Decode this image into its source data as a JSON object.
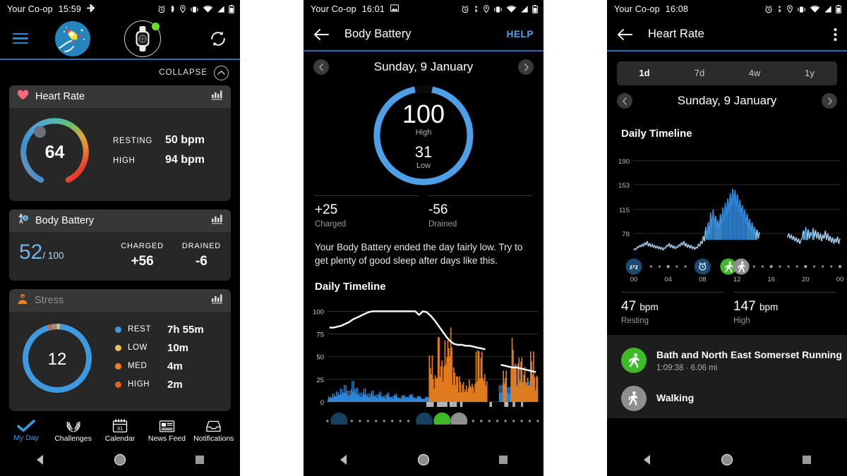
{
  "statusbar": {
    "carrier": "Your Co-op",
    "times": {
      "left": "15:59",
      "middle": "16:01",
      "right": "16:08"
    },
    "icons": [
      "alarm-icon",
      "bluetooth-icon",
      "location-icon",
      "vibrate-icon",
      "wifi-icon",
      "signal-icon",
      "battery-icon"
    ]
  },
  "left": {
    "collapse_label": "COLLAPSE",
    "heart_rate": {
      "title": "Heart Rate",
      "current": "64",
      "rows": [
        {
          "label": "RESTING",
          "value": "50 bpm"
        },
        {
          "label": "HIGH",
          "value": "94 bpm"
        }
      ]
    },
    "body_battery": {
      "title": "Body Battery",
      "value": "52",
      "denominator": "/ 100",
      "columns": [
        {
          "label": "CHARGED",
          "value": "+56"
        },
        {
          "label": "DRAINED",
          "value": "-6"
        }
      ]
    },
    "stress": {
      "title": "Stress",
      "value": "12",
      "legend": [
        {
          "label": "REST",
          "value": "7h 55m",
          "color": "#3d9ae0"
        },
        {
          "label": "LOW",
          "value": "10m",
          "color": "#f4b860"
        },
        {
          "label": "MED",
          "value": "4m",
          "color": "#ef8020"
        },
        {
          "label": "HIGH",
          "value": "2m",
          "color": "#e8601c"
        }
      ]
    },
    "bottom_nav": [
      {
        "label": "My Day",
        "icon": "check-icon",
        "active": true
      },
      {
        "label": "Challenges",
        "icon": "laurel-icon",
        "active": false
      },
      {
        "label": "Calendar",
        "icon": "calendar-icon",
        "active": false
      },
      {
        "label": "News Feed",
        "icon": "newspaper-icon",
        "active": false
      },
      {
        "label": "Notifications",
        "icon": "inbox-icon",
        "active": false
      }
    ]
  },
  "middle": {
    "title": "Body Battery",
    "help_label": "HELP",
    "date": "Sunday, 9 January",
    "gauge": {
      "high": "100",
      "high_label": "High",
      "low": "31",
      "low_label": "Low"
    },
    "stats": [
      {
        "value": "+25",
        "label": "Charged"
      },
      {
        "value": "-56",
        "label": "Drained"
      }
    ],
    "advice": "Your Body Battery ended the day fairly low. Try to get plenty of good sleep after days like this.",
    "section_title": "Daily Timeline"
  },
  "right": {
    "title": "Heart Rate",
    "segments": [
      {
        "label": "1d",
        "active": true
      },
      {
        "label": "7d",
        "active": false
      },
      {
        "label": "4w",
        "active": false
      },
      {
        "label": "1y",
        "active": false
      }
    ],
    "date": "Sunday, 9 January",
    "section_title": "Daily Timeline",
    "stats": [
      {
        "value": "47",
        "unit": "bpm",
        "label": "Resting"
      },
      {
        "value": "147",
        "unit": "bpm",
        "label": "High"
      }
    ],
    "activities": [
      {
        "name": "Bath and North East Somerset Running",
        "meta": "1:09:38 · 6.06 mi",
        "icon": "running-icon",
        "color": "#3dbb27"
      },
      {
        "name": "Walking",
        "meta": "",
        "icon": "walking-icon",
        "color": "#8f8f8f"
      }
    ]
  },
  "colors": {
    "accent_blue": "#1b72b8",
    "link_blue": "#4ca6e8",
    "running_green": "#3dbb27",
    "walking_grey": "#8f8f8f",
    "stress_orange": "#ef8020",
    "card_bg": "#272727",
    "card_head_bg": "#373737"
  },
  "chart_data": [
    {
      "type": "area",
      "title": "Daily Timeline",
      "panel": "middle-body-battery",
      "ylabel": "",
      "xlabel": "",
      "ylim": [
        0,
        105
      ],
      "yticks": [
        0,
        25,
        50,
        75,
        100
      ],
      "grid": true,
      "series": [
        {
          "name": "Body Battery",
          "color": "#ffffff",
          "type": "line",
          "x": [
            0,
            1,
            2,
            3,
            4,
            5,
            6,
            7,
            8,
            9,
            10,
            11,
            12,
            13,
            14,
            15,
            16,
            17,
            18,
            19,
            20,
            21,
            22,
            23,
            24,
            25,
            26,
            27,
            28,
            29,
            30,
            31,
            32,
            33,
            34,
            35,
            36,
            37,
            38,
            39,
            40,
            41,
            42,
            43,
            44,
            45,
            46,
            47,
            48,
            49,
            50,
            51,
            52,
            53
          ],
          "values": [
            82,
            82,
            83,
            84,
            86,
            88,
            91,
            93,
            95,
            97,
            99,
            100,
            100,
            100,
            100,
            100,
            100,
            100,
            100,
            100,
            100,
            100,
            100,
            96,
            100,
            99,
            95,
            90,
            84,
            78,
            72,
            67,
            64,
            63,
            63,
            62,
            62,
            61,
            60,
            59,
            58,
            null,
            null,
            null,
            41,
            40,
            39,
            38,
            38,
            37,
            36,
            35,
            34,
            33
          ]
        },
        {
          "name": "Rest (recovery)",
          "color": "#2f86d8",
          "type": "bar",
          "values": [
            6,
            9,
            11,
            14,
            18,
            12,
            22,
            15,
            10,
            14,
            9,
            12,
            8,
            11,
            7,
            10,
            6,
            9,
            5,
            8,
            6,
            9,
            5,
            7,
            4,
            6,
            0,
            0,
            0,
            0,
            0,
            0,
            0,
            0,
            0,
            0,
            0,
            0,
            0,
            0,
            0,
            0,
            0,
            0,
            18,
            21,
            16,
            23,
            19,
            24,
            17,
            22,
            19,
            16
          ]
        },
        {
          "name": "Stress",
          "color": "#e07b1e",
          "type": "bar",
          "values": [
            0,
            0,
            0,
            0,
            0,
            0,
            0,
            0,
            0,
            0,
            0,
            0,
            0,
            0,
            0,
            0,
            0,
            0,
            0,
            0,
            0,
            0,
            0,
            0,
            0,
            0,
            50,
            30,
            76,
            46,
            66,
            80,
            38,
            30,
            22,
            18,
            24,
            20,
            60,
            56,
            30,
            0,
            0,
            0,
            0,
            34,
            0,
            70,
            44,
            50,
            38,
            26,
            55,
            30
          ]
        }
      ],
      "timeline_icons": [
        "sleep-icon",
        "alarm-icon",
        "running-icon",
        "walking-icon"
      ]
    },
    {
      "type": "area",
      "title": "Daily Timeline",
      "panel": "right-heart-rate",
      "ylabel": "",
      "xlabel": "",
      "ylim": [
        40,
        200
      ],
      "yticks": [
        78,
        115,
        153,
        190
      ],
      "grid": true,
      "xticks": [
        "00",
        "04",
        "08",
        "12",
        "16",
        "20",
        "00"
      ],
      "series": [
        {
          "name": "Heart Rate",
          "color_low": "#9dc4e2",
          "color_mid": "#2f86d8",
          "color_high": "#5fd35f",
          "values": [
            52,
            55,
            53,
            58,
            56,
            60,
            57,
            62,
            58,
            64,
            60,
            66,
            58,
            63,
            57,
            62,
            56,
            60,
            55,
            59,
            54,
            58,
            53,
            57,
            52,
            56,
            55,
            60,
            58,
            63,
            56,
            61,
            55,
            59,
            54,
            58,
            56,
            61,
            58,
            64,
            60,
            66,
            58,
            63,
            56,
            61,
            55,
            60,
            54,
            58,
            53,
            57,
            55,
            62,
            58,
            66,
            62,
            74,
            66,
            88,
            72,
            95,
            78,
            110,
            86,
            115,
            92,
            105,
            88,
            98,
            84,
            108,
            90,
            118,
            96,
            125,
            104,
            132,
            112,
            140,
            120,
            147,
            126,
            145,
            118,
            138,
            112,
            130,
            105,
            122,
            98,
            115,
            92,
            108,
            86,
            100,
            80,
            95,
            76,
            88,
            72,
            84,
            70,
            80,
            null,
            null,
            null,
            null,
            null,
            null,
            null,
            null,
            null,
            null,
            null,
            null,
            null,
            null,
            null,
            null,
            null,
            null,
            null,
            null,
            null,
            null,
            72,
            78,
            70,
            76,
            68,
            74,
            66,
            72,
            64,
            70,
            62,
            68,
            70,
            82,
            76,
            88,
            72,
            84,
            70,
            80,
            74,
            86,
            72,
            83,
            70,
            80,
            68,
            78,
            66,
            76,
            70,
            82,
            68,
            78,
            66,
            74,
            64,
            72,
            62,
            70,
            64,
            73,
            62,
            70
          ]
        }
      ],
      "timeline_icons": [
        {
          "icon": "sleep-icon",
          "position": "00",
          "color": "#1c4a73"
        },
        {
          "icon": "alarm-icon",
          "position": "08",
          "color": "#1c4a73"
        },
        {
          "icon": "running-icon",
          "position": "11",
          "color": "#3dbb27"
        },
        {
          "icon": "walking-icon",
          "position": "12.5",
          "color": "#8f8f8f"
        }
      ]
    },
    {
      "type": "gauge",
      "panel": "left-heart-rate",
      "value": 64,
      "min": 40,
      "max": 100,
      "ring_colors": [
        "#7f95a3",
        "#3d8fd0",
        "#4da0df",
        "#4fb98a",
        "#7fbf52",
        "#e6a43c",
        "#e8601c",
        "#e63c2c"
      ]
    },
    {
      "type": "gauge",
      "panel": "left-stress",
      "value": 12,
      "ring_color": "#3d9ae0",
      "marker_colors": [
        "#e8601c",
        "#ef8020",
        "#f4b860"
      ]
    },
    {
      "type": "gauge",
      "panel": "middle-body-battery-ring",
      "high": 100,
      "low": 31,
      "ring_color": "#4da0e8"
    }
  ]
}
